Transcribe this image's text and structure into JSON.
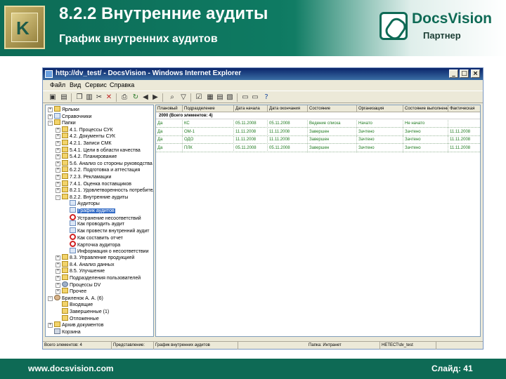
{
  "slide": {
    "title": "8.2.2  Внутренние аудиты",
    "subtitle": "График внутренних аудитов",
    "logo_initial": "K",
    "brand_name": "DocsVision",
    "brand_tagline": "Партнер",
    "footer_url": "www.docsvision.com",
    "footer_slide": "Слайд: 41",
    "colors": {
      "header": "#0e7a62",
      "footer": "#0e6a55",
      "selection": "#316ac5",
      "grid_text": "#1f7a1f"
    }
  },
  "window": {
    "title": "http://dv_test/ - DocsVision - Windows Internet Explorer",
    "controls": [
      "_",
      "□",
      "×"
    ],
    "menu": [
      "Файл",
      "Вид",
      "Сервис",
      "Справка"
    ],
    "toolbar_icons": [
      "save-icon",
      "new-folder-icon",
      "copy-icon",
      "paste-icon",
      "cut-icon",
      "delete-icon",
      "print-icon",
      "refresh-icon",
      "back-icon",
      "forward-icon",
      "search-icon",
      "filter-icon",
      "checkbox-icon",
      "view-list-icon",
      "view-details-icon",
      "view-preview-icon",
      "window-icon",
      "help-icon"
    ]
  },
  "tree": {
    "items": [
      {
        "label": "Ярлыки",
        "icon": "folder",
        "expander": "+",
        "level": 0
      },
      {
        "label": "Справочники",
        "icon": "doc",
        "expander": "+",
        "level": 0
      },
      {
        "label": "Папки",
        "icon": "folder",
        "expander": "−",
        "level": 0
      },
      {
        "label": "4.1. Процессы СУК",
        "icon": "folder",
        "expander": "+",
        "level": 1
      },
      {
        "label": "4.2. Документы СУК",
        "icon": "folder",
        "expander": "+",
        "level": 1
      },
      {
        "label": "4.2.1. Записи СМК",
        "icon": "folder",
        "expander": "+",
        "level": 1
      },
      {
        "label": "5.4.1. Цели в области качества",
        "icon": "folder",
        "expander": "+",
        "level": 1
      },
      {
        "label": "5.4.2. Планирование",
        "icon": "folder",
        "expander": "+",
        "level": 1
      },
      {
        "label": "5.6. Анализ со стороны руководства",
        "icon": "folder",
        "expander": "+",
        "level": 1
      },
      {
        "label": "6.2.2. Подготовка и аттестация",
        "icon": "folder",
        "expander": "+",
        "level": 1
      },
      {
        "label": "7.2.3. Рекламации",
        "icon": "folder",
        "expander": "+",
        "level": 1
      },
      {
        "label": "7.4.1. Оценка поставщиков",
        "icon": "folder",
        "expander": "+",
        "level": 1
      },
      {
        "label": "8.2.1. Удовлетворенность потребителя",
        "icon": "folder",
        "expander": "+",
        "level": 1
      },
      {
        "label": "8.2.2. Внутренние аудиты",
        "icon": "folder",
        "expander": "−",
        "level": 1
      },
      {
        "label": "Аудиторы",
        "icon": "doc",
        "expander": "",
        "level": 2
      },
      {
        "label": "График аудитов",
        "icon": "doc",
        "expander": "",
        "level": 2,
        "selected": true
      },
      {
        "label": "Устранение несоответствий",
        "icon": "no",
        "expander": "",
        "level": 2
      },
      {
        "label": "Как проводить аудит",
        "icon": "doc",
        "expander": "",
        "level": 2
      },
      {
        "label": "Как провести внутренний аудит",
        "icon": "doc",
        "expander": "",
        "level": 2
      },
      {
        "label": "Как составить отчет",
        "icon": "no",
        "expander": "",
        "level": 2
      },
      {
        "label": "Карточка аудитора",
        "icon": "no",
        "expander": "",
        "level": 2
      },
      {
        "label": "Информация о несоответствии",
        "icon": "doc",
        "expander": "",
        "level": 2
      },
      {
        "label": "8.3. Управление продукцией",
        "icon": "folder",
        "expander": "+",
        "level": 1
      },
      {
        "label": "8.4. Анализ данных",
        "icon": "folder",
        "expander": "+",
        "level": 1
      },
      {
        "label": "8.5. Улучшение",
        "icon": "folder",
        "expander": "+",
        "level": 1
      },
      {
        "label": "Подразделения пользователей",
        "icon": "folder",
        "expander": "+",
        "level": 1
      },
      {
        "label": "Процессы DV",
        "icon": "gear",
        "expander": "+",
        "level": 1
      },
      {
        "label": "Прочее",
        "icon": "folder",
        "expander": "+",
        "level": 1
      },
      {
        "label": "Бриленок А. А. (6)",
        "icon": "user",
        "expander": "−",
        "level": 0
      },
      {
        "label": "Входящие",
        "icon": "folder",
        "expander": "",
        "level": 1
      },
      {
        "label": "Завершенные (1)",
        "icon": "folder",
        "expander": "",
        "level": 1
      },
      {
        "label": "Отложенные",
        "icon": "folder",
        "expander": "",
        "level": 1
      },
      {
        "label": "Архив документов",
        "icon": "folder",
        "expander": "+",
        "level": 0
      },
      {
        "label": "Корзина",
        "icon": "trash",
        "expander": "",
        "level": 0
      }
    ]
  },
  "grid": {
    "columns": [
      "Плановый",
      "Подразделение",
      "Дата начала",
      "Дата окончания",
      "Состояние",
      "Организация",
      "Состояние выполнения",
      "Фактическая"
    ],
    "group_label": "2000 (Всего элементов: 4)",
    "rows": [
      [
        "Да",
        "КС",
        "05.11.2008",
        "05.11.2008",
        "Ведение списка",
        "Начато",
        "Не начато",
        ""
      ],
      [
        "Да",
        "ОМ-1",
        "11.11.2008",
        "11.11.2008",
        "Завершен",
        "Зачтено",
        "Зачтено",
        "11.11.2008"
      ],
      [
        "Да",
        "ОДО",
        "11.11.2008",
        "11.11.2008",
        "Завершен",
        "Зачтено",
        "Зачтено",
        "11.11.2008"
      ],
      [
        "Да",
        "ПЛК",
        "05.11.2008",
        "05.11.2008",
        "Завершен",
        "Зачтено",
        "Зачтено",
        "11.11.2008"
      ]
    ]
  },
  "status": {
    "cells": [
      "Всего элементов: 4",
      "Представление:",
      "График внутренних аудитов",
      "Папка: Интранет",
      "НЕТЕСТ\\dv_test"
    ]
  }
}
